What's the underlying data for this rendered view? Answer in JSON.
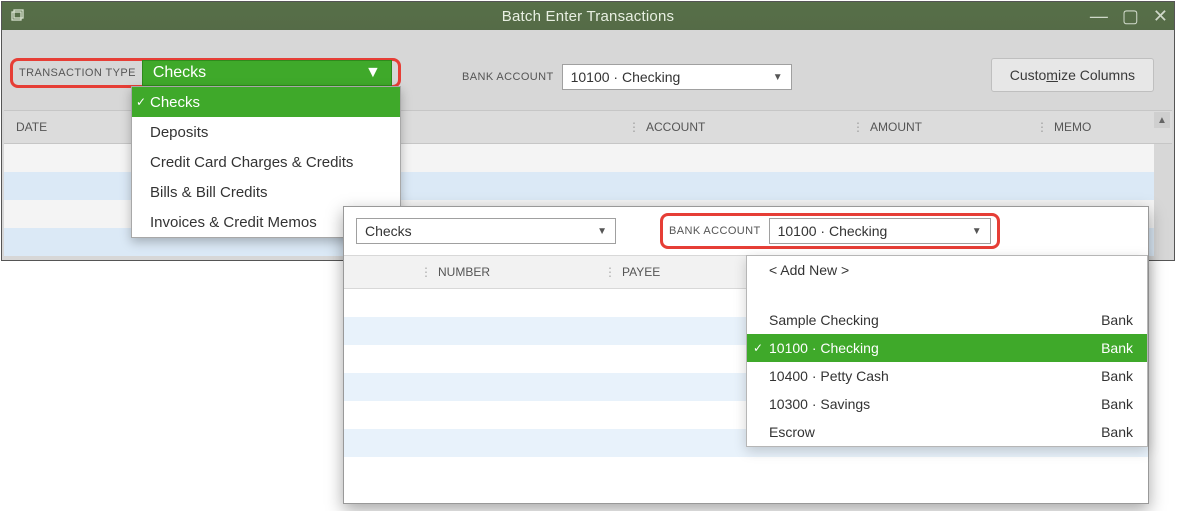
{
  "window": {
    "title": "Batch Enter Transactions"
  },
  "toolbar": {
    "transaction_type_label": "TRANSACTION TYPE",
    "transaction_type_value": "Checks",
    "bank_account_label": "BANK ACCOUNT",
    "bank_account_value": "10100 · Checking",
    "customize_btn_pre": "Custo",
    "customize_btn_u": "m",
    "customize_btn_post": "ize Columns"
  },
  "columns": {
    "date": "DATE",
    "number": "NUMBER",
    "payee": "PAYEE",
    "account": "ACCOUNT",
    "amount": "AMOUNT",
    "memo": "MEMO"
  },
  "tx_dropdown": {
    "items": [
      {
        "label": "Checks",
        "selected": true
      },
      {
        "label": "Deposits"
      },
      {
        "label": "Credit Card Charges & Credits"
      },
      {
        "label": "Bills & Bill Credits"
      },
      {
        "label": "Invoices & Credit Memos"
      }
    ]
  },
  "panel2": {
    "tx_value": "Checks",
    "bank_account_label": "BANK ACCOUNT",
    "bank_account_value": "10100 · Checking",
    "columns": {
      "number": "NUMBER",
      "payee": "PAYEE"
    }
  },
  "ba_dropdown": {
    "addnew": "< Add New >",
    "items": [
      {
        "name": "Sample Checking",
        "type": "Bank"
      },
      {
        "name": "10100 · Checking",
        "type": "Bank",
        "selected": true
      },
      {
        "name": "10400 · Petty Cash",
        "type": "Bank"
      },
      {
        "name": "10300 · Savings",
        "type": "Bank"
      },
      {
        "name": "Escrow",
        "type": "Bank"
      }
    ]
  }
}
